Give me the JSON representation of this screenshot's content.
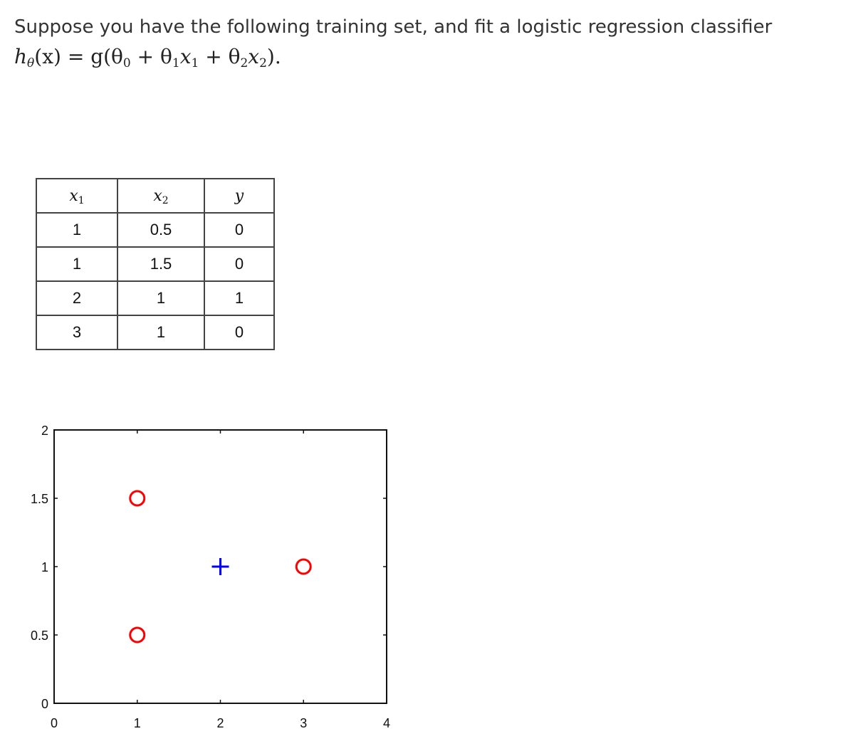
{
  "question": {
    "text": "Suppose you have the following training set, and fit a logistic regression classifier",
    "formula": {
      "h": "h",
      "theta": "θ",
      "rest1": "(x) = g(θ",
      "sub0": "0",
      "rest2": " + θ",
      "sub1a": "1",
      "x": "x",
      "sub1b": "1",
      "rest3": " + θ",
      "sub2a": "2",
      "x2": "x",
      "sub2b": "2",
      "end": ")."
    }
  },
  "table": {
    "headers": [
      {
        "var": "x",
        "sub": "1"
      },
      {
        "var": "x",
        "sub": "2"
      },
      {
        "var": "y",
        "sub": ""
      }
    ],
    "rows": [
      [
        "1",
        "0.5",
        "0"
      ],
      [
        "1",
        "1.5",
        "0"
      ],
      [
        "2",
        "1",
        "1"
      ],
      [
        "3",
        "1",
        "0"
      ]
    ]
  },
  "chart_data": {
    "type": "scatter",
    "title": "",
    "xlabel": "",
    "ylabel": "",
    "xlim": [
      0,
      4
    ],
    "ylim": [
      0,
      2
    ],
    "xticks": [
      "0",
      "1",
      "2",
      "3",
      "4"
    ],
    "yticks": [
      "0",
      "0.5",
      "1",
      "1.5",
      "2"
    ],
    "grid": false,
    "series": [
      {
        "marker": "circle",
        "color": "#ff0000",
        "points": [
          [
            1,
            0.5
          ],
          [
            1,
            1.5
          ],
          [
            3,
            1
          ]
        ]
      },
      {
        "marker": "plus",
        "color": "#0000ff",
        "points": [
          [
            2,
            1
          ]
        ]
      }
    ]
  }
}
